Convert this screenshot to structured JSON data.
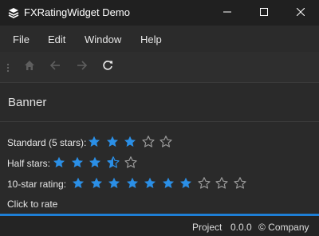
{
  "window": {
    "title": "FXRatingWidget Demo",
    "icon": "stack-layers-icon",
    "controls": [
      "minimize-icon",
      "maximize-icon",
      "close-icon"
    ]
  },
  "menu": {
    "items": [
      {
        "label": "File"
      },
      {
        "label": "Edit"
      },
      {
        "label": "Window"
      },
      {
        "label": "Help"
      }
    ]
  },
  "toolbar": {
    "buttons": [
      {
        "name": "home-icon",
        "enabled": false
      },
      {
        "name": "arrow-left-icon",
        "enabled": false
      },
      {
        "name": "arrow-right-icon",
        "enabled": false
      },
      {
        "name": "refresh-icon",
        "enabled": true
      }
    ]
  },
  "banner": {
    "text": "Banner"
  },
  "ratings": [
    {
      "label": "Standard (5 stars):",
      "value": 3,
      "max": 5
    },
    {
      "label": "Half stars:",
      "value": 3.5,
      "max": 5
    },
    {
      "label": "10-star rating:",
      "value": 7,
      "max": 10
    }
  ],
  "hint": {
    "text": "Click to rate"
  },
  "status": {
    "project": "Project",
    "version": "0.0.0",
    "company": "© Company"
  },
  "colors": {
    "accent": "#1e7fd6",
    "star_filled": "#2b8fe6",
    "star_empty": "#9a9a9a"
  }
}
